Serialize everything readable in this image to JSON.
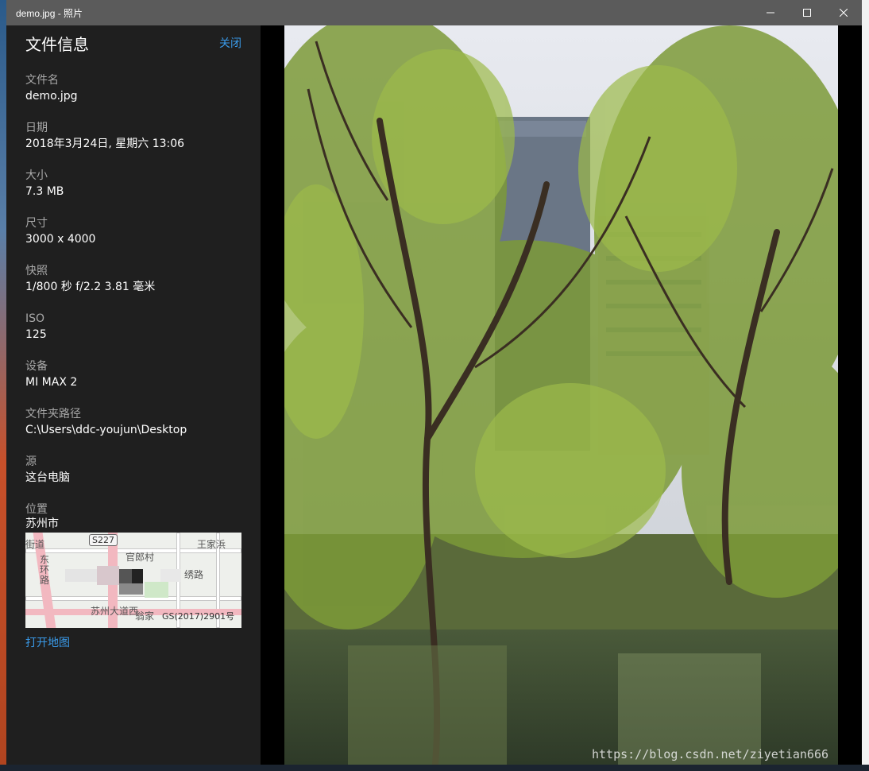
{
  "window": {
    "title": "demo.jpg - 照片",
    "controls": [
      "minimize-icon",
      "maximize-icon",
      "close-icon"
    ]
  },
  "panel": {
    "title": "文件信息",
    "close_label": "关闭",
    "fields": [
      {
        "label": "文件名",
        "value": "demo.jpg"
      },
      {
        "label": "日期",
        "value": "2018年3月24日, 星期六 13:06"
      },
      {
        "label": "大小",
        "value": "7.3 MB"
      },
      {
        "label": "尺寸",
        "value": "3000 x 4000"
      },
      {
        "label": "快照",
        "value": "1/800 秒 f/2.2 3.81 毫米"
      },
      {
        "label": "ISO",
        "value": "125"
      },
      {
        "label": "设备",
        "value": "MI MAX 2"
      },
      {
        "label": "文件夹路径",
        "value": "C:\\Users\\ddc-youjun\\Desktop"
      },
      {
        "label": "源",
        "value": "这台电脑"
      }
    ],
    "location": {
      "label": "位置",
      "value": "苏州市",
      "map": {
        "shield": "S227",
        "labels": [
          "官郎村",
          "王家浜",
          "东环路",
          "苏州大道西",
          "翁家",
          "绣路",
          "GS(2017)2901号",
          "街道"
        ]
      },
      "open_map_label": "打开地图"
    }
  },
  "photo": {
    "subject": "willow trees by a river with high-rise buildings",
    "watermark": "https://blog.csdn.net/ziyetian666"
  },
  "colors": {
    "accent": "#3a9ae8",
    "panel_bg": "#1f1f1f",
    "titlebar_bg": "#5b5b5b"
  }
}
